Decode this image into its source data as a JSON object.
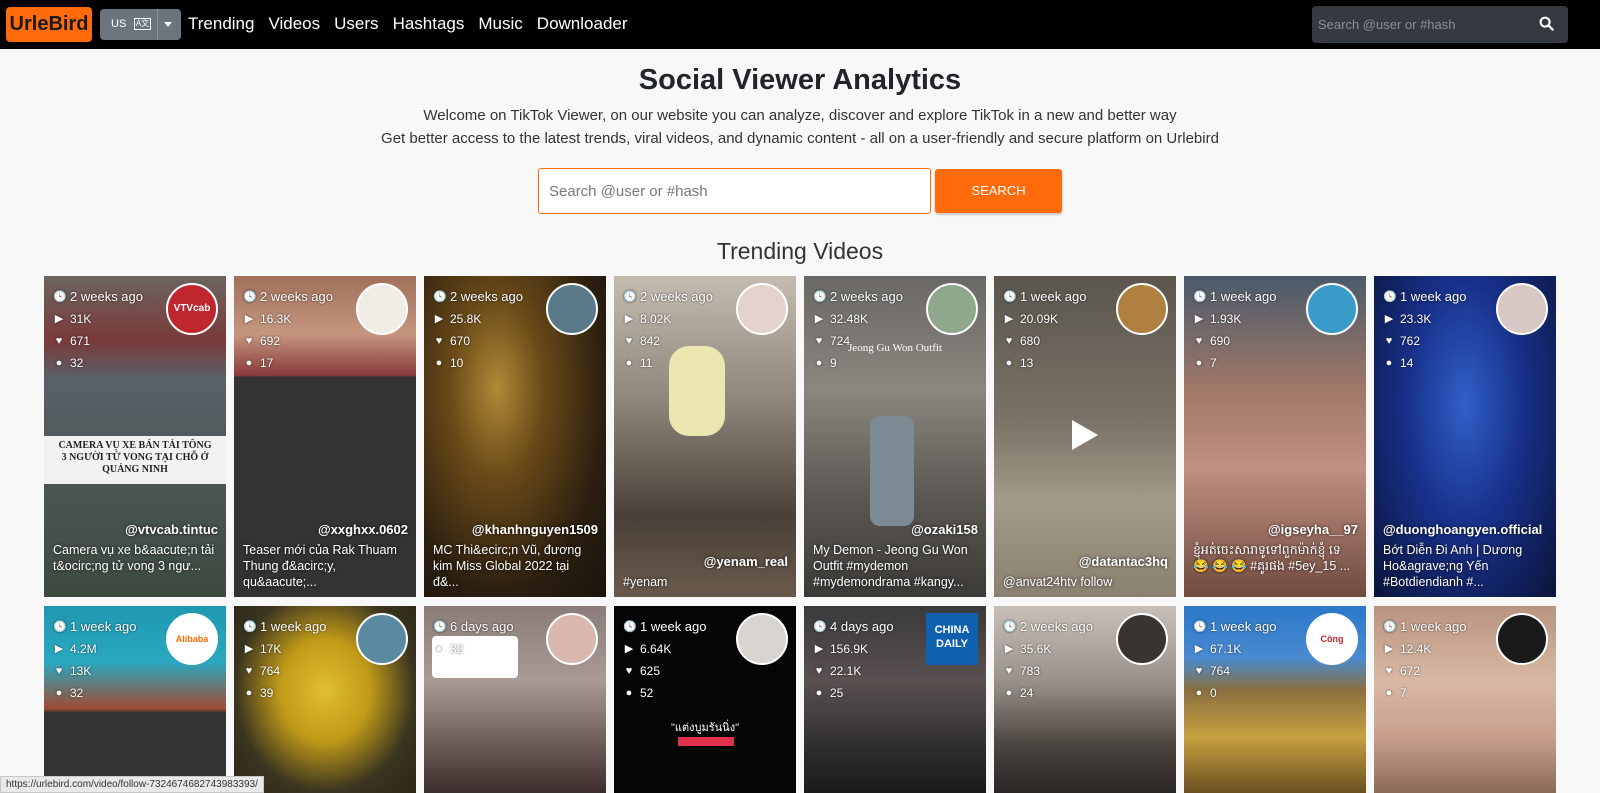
{
  "navbar": {
    "logo": "UrleBird",
    "lang_code": "US",
    "lang_flag": "A文",
    "links": [
      "Trending",
      "Videos",
      "Users",
      "Hashtags",
      "Music",
      "Downloader"
    ],
    "search_placeholder": "Search @user or #hash"
  },
  "hero": {
    "title": "Social Viewer Analytics",
    "subtitle1": "Welcome on TikTok Viewer, on our website you can analyze, discover and explore TikTok in a new and better way",
    "subtitle2": "Get better access to the latest trends, viral videos, and dynamic content - all on a user-friendly and secure platform on Urlebird",
    "search_placeholder": "Search @user or #hash",
    "search_button": "SEARCH"
  },
  "section_title": "Trending Videos",
  "accent_color": "#ff6a0a",
  "cards_row1": [
    {
      "time": "2 weeks ago",
      "plays": "31K",
      "likes": "671",
      "comments": "32",
      "user": "@vtvcab.tintuc",
      "desc": "Camera vụ xe b&aacute;n tải t&ocirc;ng tử vong 3 ngư...",
      "banner": "CAMERA VỤ XE BÁN TẢI TÔNG 3 NGƯỜI TỬ VONG TẠI CHỖ Ở QUẢNG NINH",
      "avatar_text": "VTVcab"
    },
    {
      "time": "2 weeks ago",
      "plays": "16.3K",
      "likes": "692",
      "comments": "17",
      "user": "@xxghxx.0602",
      "desc": "Teaser mới của Rak Thuam Thung đ&acirc;y, qu&aacute;...",
      "avatar_text": ""
    },
    {
      "time": "2 weeks ago",
      "plays": "25.8K",
      "likes": "670",
      "comments": "10",
      "user": "@khanhnguyen1509",
      "desc": "MC Thi&ecirc;n Vũ, đương kim Miss Global 2022 tại đ&...",
      "avatar_text": ""
    },
    {
      "time": "2 weeks ago",
      "plays": "8.02K",
      "likes": "842",
      "comments": "11",
      "user": "@yenam_real",
      "desc": "#yenam",
      "avatar_text": ""
    },
    {
      "time": "2 weeks ago",
      "plays": "32.48K",
      "likes": "724",
      "comments": "9",
      "user": "@ozaki158",
      "desc": "My Demon - Jeong Gu Won Outfit #mydemon #mydemondrama #kangy...",
      "overlay": "Jeong Gu Won Outfit",
      "avatar_text": ""
    },
    {
      "time": "1 week ago",
      "plays": "20.09K",
      "likes": "680",
      "comments": "13",
      "user": "@datantac3hq",
      "desc": "@anvat24htv follow",
      "avatar_text": ""
    },
    {
      "time": "1 week ago",
      "plays": "1.93K",
      "likes": "690",
      "comments": "7",
      "user": "@igseyha__97",
      "desc": "ខ្ញុំអត់ចេះសារាទូទៅពួកម៉ាក់ខ្ញុំ ទេ 😂 😂 😂 #គូរផង #5ey_15 ...",
      "avatar_text": ""
    },
    {
      "time": "1 week ago",
      "plays": "23.3K",
      "likes": "762",
      "comments": "14",
      "user": "@duonghoangyen.official",
      "desc": "Bớt Diễn Đi Anh | Dương Ho&agrave;ng Yến #Botdiendianh #...",
      "avatar_text": ""
    }
  ],
  "cards_row2": [
    {
      "time": "1 week ago",
      "plays": "4.2M",
      "likes": "13K",
      "comments": "32",
      "avatar_text": "Alibaba Cloud"
    },
    {
      "time": "1 week ago",
      "plays": "17K",
      "likes": "764",
      "comments": "39",
      "avatar_text": ""
    },
    {
      "time": "6 days ago",
      "plays": "",
      "likes": "",
      "comments": "32",
      "avatar_text": ""
    },
    {
      "time": "1 week ago",
      "plays": "6.64K",
      "likes": "625",
      "comments": "52",
      "overlay": "\"แต่งบูมรันนิ่ง\"",
      "avatar_text": ""
    },
    {
      "time": "4 days ago",
      "plays": "156.9K",
      "likes": "22.1K",
      "comments": "25",
      "avatar_text": "CHINA DAILY"
    },
    {
      "time": "2 weeks ago",
      "plays": "35.6K",
      "likes": "783",
      "comments": "24",
      "avatar_text": ""
    },
    {
      "time": "1 week ago",
      "plays": "67.1K",
      "likes": "764",
      "comments": "0",
      "avatar_text": "Công Thương"
    },
    {
      "time": "1 week ago",
      "plays": "12.4K",
      "likes": "672",
      "comments": "7",
      "avatar_text": ""
    }
  ],
  "status_url": "https://urlebird.com/video/follow-7324674682743983393/"
}
